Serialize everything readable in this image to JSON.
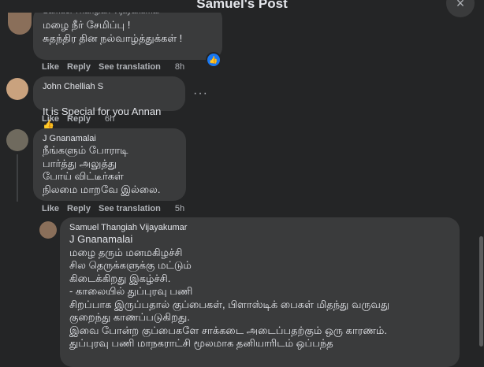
{
  "header": {
    "title": "Samuel's Post",
    "close_icon": "×"
  },
  "comments": [
    {
      "author": "Samuel Thangiah Vijayakumar",
      "text": "மழை நீர் சேமிப்பு !\nசுதந்திர தின நல்வாழ்த்துக்கள் !",
      "actions": {
        "like": "Like",
        "reply": "Reply",
        "see_translation": "See translation",
        "time": "8h"
      },
      "reaction_icon": "like-reaction-icon"
    },
    {
      "author": "John Chelliah S",
      "text": "It is Special for you Annan",
      "emoji": "👍",
      "actions": {
        "like": "Like",
        "reply": "Reply",
        "time": "6h"
      },
      "more": "···"
    },
    {
      "author": "J Gnanamalai",
      "text": "நீங்களும் போராடி\nபார்த்து அலுத்து\nபோய் விட்டீர்கள்\nநிலமை மாறவே இல்லை.",
      "actions": {
        "like": "Like",
        "reply": "Reply",
        "see_translation": "See translation",
        "time": "5h"
      }
    },
    {
      "author": "Samuel Thangiah Vijayakumar",
      "mention": "J Gnanamalai",
      "text": "மழை தரும் மனமகிழச்சி\nசில தெருக்களுக்கு மட்டும்\nகிடைக்கிறது இகழ்ச்சி.\n- காலையில் துப்புரவு பணி\nசிறப்பாக இருப்பதால் குப்பைகள், பிளாஸ்டிக் பைகள் மிதந்து வருவது\nகுறைந்து காணப்படுகிறது.\nஇவை போன்ற குப்பைகளே சாக்கடை அடைப்பதற்கும் ஒரு காரணம்.\nதுப்புரவு பணி மாநகராட்சி மூலமாக தனியாரிடம் ஒப்பந்த"
    }
  ],
  "colors": {
    "background": "#242526",
    "bubble": "#3a3b3c",
    "text": "#e4e6eb",
    "secondary": "#b0b3b8",
    "reaction_blue": "#1877f2"
  }
}
